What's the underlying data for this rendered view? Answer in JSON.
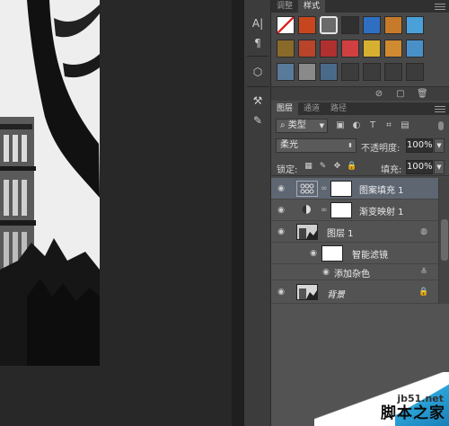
{
  "styles_panel": {
    "tabs": [
      "调整",
      "样式"
    ],
    "active_tab": "样式",
    "swatch_colors": [
      [
        "#ffffff",
        "#c8461e",
        "#6a6a6a",
        "#303030",
        "#2f6fc2",
        "#c77a2a",
        "#4aa0d8"
      ],
      [
        "#8a6a2a",
        "#b8442a",
        "#b03030",
        "#d04040",
        "#d8b030",
        "#d08a30",
        "#4a90c8"
      ],
      [
        "#5a7a9a",
        "#8a8a8a",
        "#4a6a8a",
        "#3c3c3c",
        "#3c3c3c",
        "#3c3c3c",
        "#3c3c3c"
      ]
    ],
    "footer_icons": [
      "no-style-icon",
      "new-style-icon",
      "trash-icon"
    ]
  },
  "layers_panel": {
    "tabs": [
      "图层",
      "通道",
      "路径"
    ],
    "active_tab": "图层",
    "kind_filter": "类型",
    "blend_mode": "柔光",
    "opacity_label": "不透明度:",
    "opacity_value": "100%",
    "lock_label": "锁定:",
    "fill_label": "填充:",
    "fill_value": "100%",
    "layers": [
      {
        "name": "图案填充 1",
        "selected": true,
        "visible": true,
        "type": "pattern-fill"
      },
      {
        "name": "渐变映射 1",
        "selected": false,
        "visible": true,
        "type": "gradient-map"
      },
      {
        "name": "图层 1",
        "selected": false,
        "visible": true,
        "type": "smart-object"
      },
      {
        "name": "智能滤镜",
        "selected": false,
        "visible": true,
        "type": "smart-filters"
      },
      {
        "name": "添加杂色",
        "selected": false,
        "visible": true,
        "type": "filter-effect"
      },
      {
        "name": "背景",
        "selected": false,
        "visible": true,
        "type": "background",
        "italic": true
      }
    ]
  },
  "watermark": {
    "url": "jb51.net",
    "brand": "脚本之家"
  }
}
